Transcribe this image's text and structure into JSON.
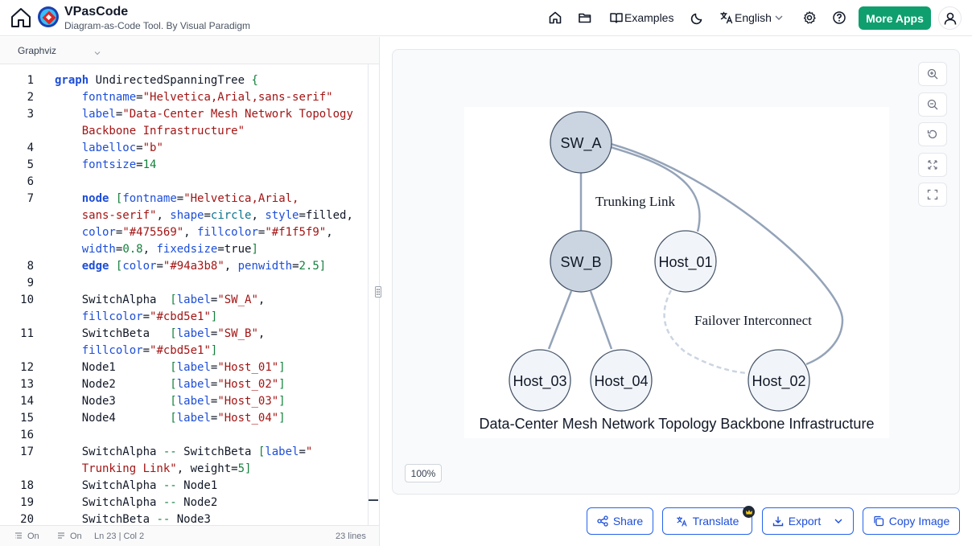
{
  "app": {
    "title": "VPasCode",
    "subtitle": "Diagram-as-Code Tool. By Visual Paradigm"
  },
  "nav": {
    "examples": "Examples",
    "language": "English",
    "more_apps": "More Apps"
  },
  "editor": {
    "language": "Graphviz",
    "lines": [
      {
        "n": "1",
        "html": "<span class='kw'>graph</span> UndirectedSpanningTree <span class='br'>{</span>"
      },
      {
        "n": "2",
        "html": "    <span class='at'>fontname</span>=<span class='str'>\"Helvetica,Arial,sans-serif\"</span>"
      },
      {
        "n": "3",
        "html": "    <span class='at'>label</span>=<span class='str'>\"Data-Center Mesh Network Topology</span>"
      },
      {
        "n": "",
        "html": "    <span class='str'>Backbone Infrastructure\"</span>"
      },
      {
        "n": "4",
        "html": "    <span class='at'>labelloc</span>=<span class='str'>\"b\"</span>"
      },
      {
        "n": "5",
        "html": "    <span class='at'>fontsize</span>=<span class='num'>14</span>"
      },
      {
        "n": "6",
        "html": ""
      },
      {
        "n": "7",
        "html": "    <span class='kw'>node</span> <span class='br'>[</span><span class='at'>fontname</span>=<span class='str'>\"Helvetica,Arial,</span>"
      },
      {
        "n": "",
        "html": "    <span class='str'>sans-serif\"</span>, <span class='at'>shape</span>=<span class='en'>circle</span>, <span class='at'>style</span>=filled,"
      },
      {
        "n": "",
        "html": "    <span class='at'>color</span>=<span class='str'>\"#475569\"</span>, <span class='at'>fillcolor</span>=<span class='str'>\"#f1f5f9\"</span>,"
      },
      {
        "n": "",
        "html": "    <span class='at'>width</span>=<span class='num'>0.8</span>, <span class='at'>fixedsize</span>=true<span class='br'>]</span>"
      },
      {
        "n": "8",
        "html": "    <span class='kw'>edge</span> <span class='br'>[</span><span class='at'>color</span>=<span class='str'>\"#94a3b8\"</span>, <span class='at'>penwidth</span>=<span class='num'>2.5</span><span class='br'>]</span>"
      },
      {
        "n": "9",
        "html": ""
      },
      {
        "n": "10",
        "html": "    SwitchAlpha  <span class='br'>[</span><span class='at'>label</span>=<span class='str'>\"SW_A\"</span>,"
      },
      {
        "n": "",
        "html": "    <span class='at'>fillcolor</span>=<span class='str'>\"#cbd5e1\"</span><span class='br'>]</span>"
      },
      {
        "n": "11",
        "html": "    SwitchBeta   <span class='br'>[</span><span class='at'>label</span>=<span class='str'>\"SW_B\"</span>,"
      },
      {
        "n": "",
        "html": "    <span class='at'>fillcolor</span>=<span class='str'>\"#cbd5e1\"</span><span class='br'>]</span>"
      },
      {
        "n": "12",
        "html": "    Node1        <span class='br'>[</span><span class='at'>label</span>=<span class='str'>\"Host_01\"</span><span class='br'>]</span>"
      },
      {
        "n": "13",
        "html": "    Node2        <span class='br'>[</span><span class='at'>label</span>=<span class='str'>\"Host_02\"</span><span class='br'>]</span>"
      },
      {
        "n": "14",
        "html": "    Node3        <span class='br'>[</span><span class='at'>label</span>=<span class='str'>\"Host_03\"</span><span class='br'>]</span>"
      },
      {
        "n": "15",
        "html": "    Node4        <span class='br'>[</span><span class='at'>label</span>=<span class='str'>\"Host_04\"</span><span class='br'>]</span>"
      },
      {
        "n": "16",
        "html": ""
      },
      {
        "n": "17",
        "html": "    SwitchAlpha <span class='op'>--</span> SwitchBeta <span class='br'>[</span><span class='at'>label</span>=<span class='str'>\"</span>"
      },
      {
        "n": "",
        "html": "    <span class='str'>Trunking Link\"</span>, weight=<span class='num'>5</span><span class='br'>]</span>"
      },
      {
        "n": "18",
        "html": "    SwitchAlpha <span class='op'>--</span> Node1"
      },
      {
        "n": "19",
        "html": "    SwitchAlpha <span class='op'>--</span> Node2"
      },
      {
        "n": "20",
        "html": "    SwitchBeta <span class='op'>--</span> Node3"
      }
    ]
  },
  "status": {
    "wrap": "On",
    "minimap": "On",
    "cursor": "Ln 23 | Col 2",
    "total": "23 lines"
  },
  "preview": {
    "zoom": "100%",
    "diagram": {
      "nodes": [
        {
          "id": "sw_a",
          "label": "SW_A",
          "fill": "#cbd5e1"
        },
        {
          "id": "sw_b",
          "label": "SW_B",
          "fill": "#cbd5e1"
        },
        {
          "id": "host_01",
          "label": "Host_01",
          "fill": "#f1f5f9"
        },
        {
          "id": "host_02",
          "label": "Host_02",
          "fill": "#f1f5f9"
        },
        {
          "id": "host_03",
          "label": "Host_03",
          "fill": "#f1f5f9"
        },
        {
          "id": "host_04",
          "label": "Host_04",
          "fill": "#f1f5f9"
        }
      ],
      "edge_labels": {
        "trunking": "Trunking Link",
        "failover": "Failover Interconnect"
      },
      "caption": "Data-Center Mesh Network Topology Backbone Infrastructure",
      "edge_color": "#94a3b8",
      "node_border": "#475569"
    }
  },
  "actions": {
    "share": "Share",
    "translate": "Translate",
    "export": "Export",
    "copy_image": "Copy Image"
  }
}
